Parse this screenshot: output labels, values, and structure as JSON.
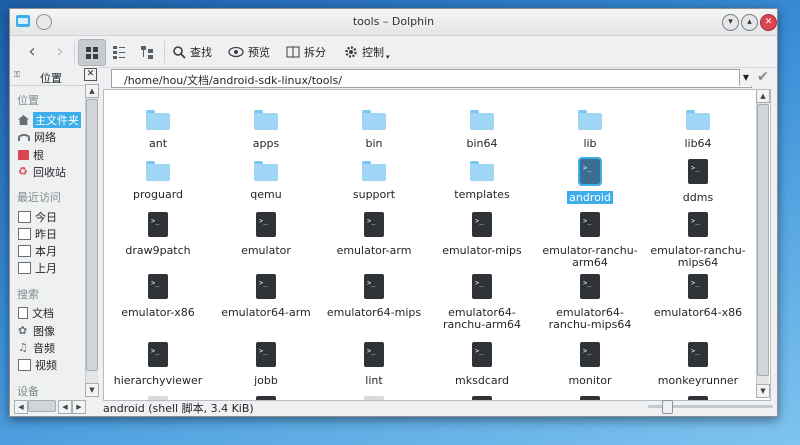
{
  "window": {
    "title": "tools – Dolphin"
  },
  "toolbar": {
    "find": "查找",
    "preview": "预览",
    "split": "拆分",
    "control": "控制"
  },
  "places": {
    "header": "位置",
    "sections": {
      "places": "位置",
      "recent": "最近访问",
      "search": "搜索",
      "devices": "设备"
    },
    "place_items": [
      "主文件夹",
      "网络",
      "根",
      "回收站"
    ],
    "recent_items": [
      "今日",
      "昨日",
      "本月",
      "上月"
    ],
    "search_items": [
      "文档",
      "图像",
      "音频",
      "视频"
    ]
  },
  "location": {
    "path": "/home/hou/文档/android-sdk-linux/tools/"
  },
  "files": [
    {
      "name": "ant",
      "kind": "folder"
    },
    {
      "name": "apps",
      "kind": "folder"
    },
    {
      "name": "bin",
      "kind": "folder"
    },
    {
      "name": "bin64",
      "kind": "folder"
    },
    {
      "name": "lib",
      "kind": "folder"
    },
    {
      "name": "lib64",
      "kind": "folder"
    },
    {
      "name": "proguard",
      "kind": "folder"
    },
    {
      "name": "qemu",
      "kind": "folder"
    },
    {
      "name": "support",
      "kind": "folder"
    },
    {
      "name": "templates",
      "kind": "folder"
    },
    {
      "name": "android",
      "kind": "script",
      "selected": true
    },
    {
      "name": "ddms",
      "kind": "script"
    },
    {
      "name": "draw9patch",
      "kind": "script"
    },
    {
      "name": "emulator",
      "kind": "script"
    },
    {
      "name": "emulator-arm",
      "kind": "script"
    },
    {
      "name": "emulator-mips",
      "kind": "script"
    },
    {
      "name": "emulator-ranchu-arm64",
      "kind": "script"
    },
    {
      "name": "emulator-ranchu-mips64",
      "kind": "script"
    },
    {
      "name": "emulator-x86",
      "kind": "script"
    },
    {
      "name": "emulator64-arm",
      "kind": "script"
    },
    {
      "name": "emulator64-mips",
      "kind": "script"
    },
    {
      "name": "emulator64-ranchu-arm64",
      "kind": "script"
    },
    {
      "name": "emulator64-ranchu-mips64",
      "kind": "script"
    },
    {
      "name": "emulator64-x86",
      "kind": "script"
    },
    {
      "name": "hierarchyviewer",
      "kind": "script"
    },
    {
      "name": "jobb",
      "kind": "script"
    },
    {
      "name": "lint",
      "kind": "script"
    },
    {
      "name": "mksdcard",
      "kind": "script"
    },
    {
      "name": "monitor",
      "kind": "script"
    },
    {
      "name": "monkeyrunner",
      "kind": "script"
    }
  ],
  "status": {
    "text": "android (shell 脚本, 3.4 KiB)"
  },
  "zoom": {
    "level": 0.12
  },
  "colors": {
    "accent": "#3daee9",
    "folder": "#9fd6f6",
    "script": "#2f3337"
  }
}
